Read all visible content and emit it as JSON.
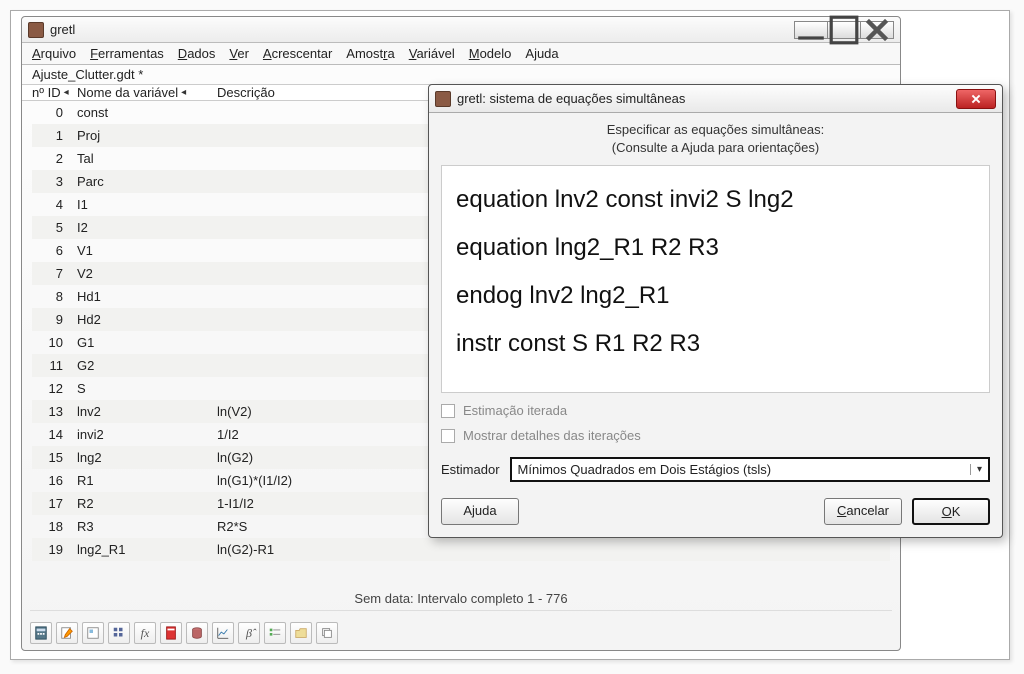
{
  "main": {
    "title": "gretl",
    "menu": [
      "Arquivo",
      "Ferramentas",
      "Dados",
      "Ver",
      "Acrescentar",
      "Amostra",
      "Variável",
      "Modelo",
      "Ajuda"
    ],
    "menu_accel": [
      0,
      0,
      0,
      0,
      0,
      5,
      0,
      0,
      1
    ],
    "filename": "Ajuste_Clutter.gdt *",
    "col_id": "nº ID",
    "col_name": "Nome da variável",
    "col_desc": "Descrição",
    "vars": [
      {
        "id": "0",
        "name": "const",
        "desc": ""
      },
      {
        "id": "1",
        "name": "Proj",
        "desc": ""
      },
      {
        "id": "2",
        "name": "Tal",
        "desc": ""
      },
      {
        "id": "3",
        "name": "Parc",
        "desc": ""
      },
      {
        "id": "4",
        "name": "I1",
        "desc": ""
      },
      {
        "id": "5",
        "name": "I2",
        "desc": ""
      },
      {
        "id": "6",
        "name": "V1",
        "desc": ""
      },
      {
        "id": "7",
        "name": "V2",
        "desc": ""
      },
      {
        "id": "8",
        "name": "Hd1",
        "desc": ""
      },
      {
        "id": "9",
        "name": "Hd2",
        "desc": ""
      },
      {
        "id": "10",
        "name": "G1",
        "desc": ""
      },
      {
        "id": "11",
        "name": "G2",
        "desc": ""
      },
      {
        "id": "12",
        "name": "S",
        "desc": ""
      },
      {
        "id": "13",
        "name": "lnv2",
        "desc": "ln(V2)"
      },
      {
        "id": "14",
        "name": "invi2",
        "desc": "1/I2"
      },
      {
        "id": "15",
        "name": "lng2",
        "desc": "ln(G2)"
      },
      {
        "id": "16",
        "name": "R1",
        "desc": "ln(G1)*(I1/I2)"
      },
      {
        "id": "17",
        "name": "R2",
        "desc": "1-I1/I2"
      },
      {
        "id": "18",
        "name": "R3",
        "desc": "R2*S"
      },
      {
        "id": "19",
        "name": "lng2_R1",
        "desc": "ln(G2)-R1"
      }
    ],
    "status": "Sem data: Intervalo completo 1 - 776",
    "tools": [
      "calc",
      "edit",
      "session",
      "stats",
      "fx",
      "pdf",
      "db",
      "plot",
      "beta",
      "list",
      "folder",
      "window"
    ]
  },
  "dialog": {
    "title": "gretl: sistema de equações simultâneas",
    "msg1": "Especificar as equações simultâneas:",
    "msg2": "(Consulte a Ajuda para orientações)",
    "equations": [
      "equation lnv2 const invi2 S lng2",
      "equation lng2_R1 R2 R3",
      "endog lnv2 lng2_R1",
      "instr const S R1 R2 R3"
    ],
    "check1": "Estimação iterada",
    "check2": "Mostrar detalhes das iterações",
    "estimator_label": "Estimador",
    "estimator_value": "Mínimos Quadrados em Dois Estágios (tsls)",
    "btn_help": "Ajuda",
    "btn_cancel": "Cancelar",
    "btn_ok": "OK"
  }
}
